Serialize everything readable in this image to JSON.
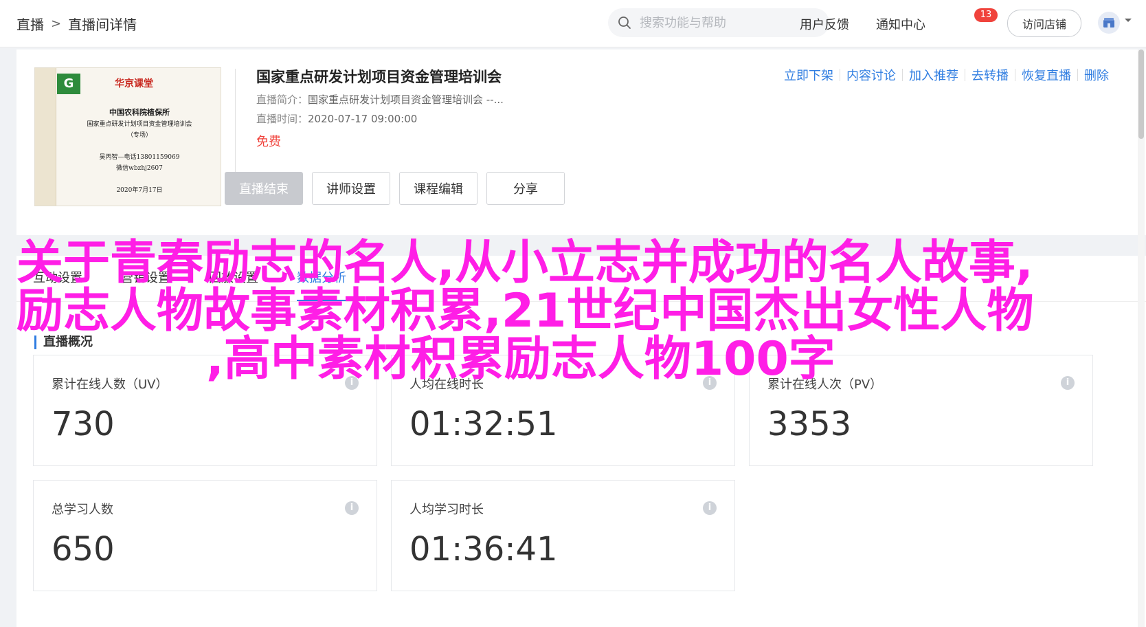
{
  "breadcrumb": {
    "root": "直播",
    "separator": ">",
    "current": "直播间详情"
  },
  "search": {
    "placeholder": "搜索功能与帮助"
  },
  "header": {
    "feedback": "用户反馈",
    "notifications": "通知中心",
    "notification_count": "13",
    "visit_store": "访问店铺"
  },
  "course": {
    "cover": {
      "brand": "华京课堂",
      "org": "中国农科院植保所",
      "title": "国家重点研发计划项目资金管理培训会",
      "tag": "（专场）",
      "contact": "吴丙智—电话13801159069",
      "wechat": "微信wbzhj2607",
      "date": "2020年7月17日"
    },
    "title": "国家重点研发计划项目资金管理培训会",
    "desc_label": "直播简介：",
    "desc_value": "国家重点研发计划项目资金管理培训会 --...",
    "time_label": "直播时间：",
    "time_value": "2020-07-17 09:00:00",
    "price": "免费",
    "buttons": [
      "直播结束",
      "讲师设置",
      "课程编辑",
      "分享"
    ],
    "actions": [
      "立即下架",
      "内容讨论",
      "加入推荐",
      "去转播",
      "恢复直播",
      "删除"
    ]
  },
  "tabs": [
    "互动设置",
    "营销设置",
    "回放设置",
    "数据分析"
  ],
  "active_tab": "数据分析",
  "section_title": "直播概况",
  "stats": [
    {
      "label": "累计在线人数（UV）",
      "value": "730"
    },
    {
      "label": "人均在线时长",
      "value": "01:32:51"
    },
    {
      "label": "累计在线人次（PV）",
      "value": "3353"
    },
    {
      "label": "总学习人数",
      "value": "650"
    },
    {
      "label": "人均学习时长",
      "value": "01:36:41"
    }
  ],
  "overlay": {
    "line1": "关于青春励志的名人,从小立志并成功的名人故事,",
    "line2": "励志人物故事素材积累,21世纪中国杰出女性人物",
    "line3": ",高中素材积累励志人物100字"
  },
  "colors": {
    "accent": "#2f7de1",
    "danger": "#f0433c",
    "overlay": "#ff1ee6"
  }
}
